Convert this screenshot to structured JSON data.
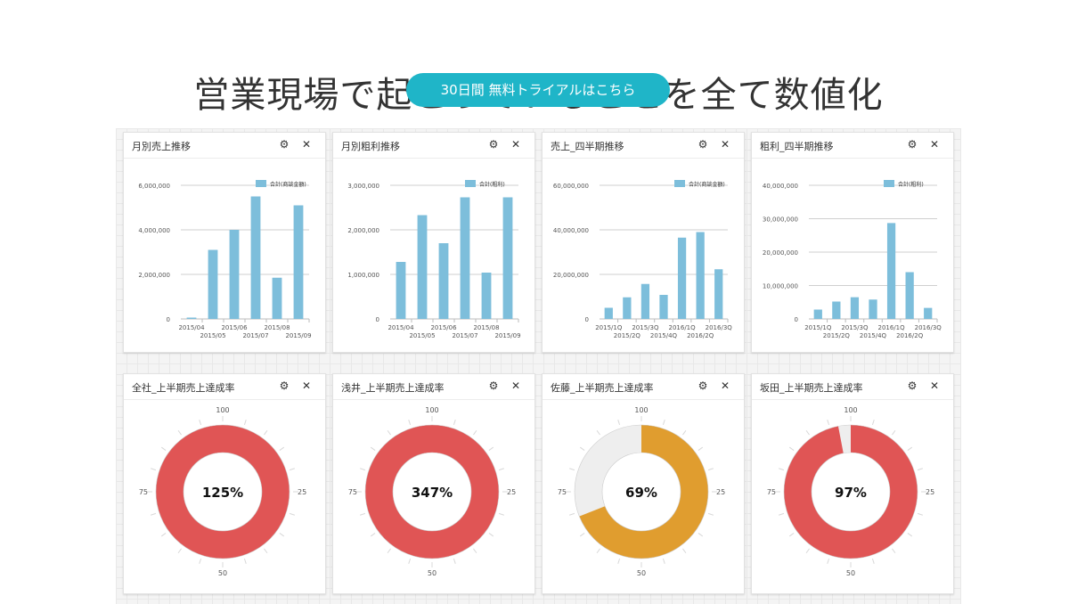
{
  "hero": {
    "headline": "営業現場で起こっていることを全て数値化",
    "cta_label": "30日間 無料トライアルはこちら"
  },
  "controls": {
    "gear_icon": "gear-icon",
    "close_icon": "close-icon"
  },
  "colors": {
    "bar": "#7dbedb",
    "red": "#e05555",
    "orange": "#e09d2f",
    "track": "#eeeeee",
    "cta": "#1fb5c8"
  },
  "panels": [
    {
      "title": "月別売上推移"
    },
    {
      "title": "月別粗利推移"
    },
    {
      "title": "売上_四半期推移"
    },
    {
      "title": "粗利_四半期推移"
    },
    {
      "title": "全社_上半期売上達成率"
    },
    {
      "title": "浅井_上半期売上達成率"
    },
    {
      "title": "佐藤_上半期売上達成率"
    },
    {
      "title": "坂田_上半期売上達成率"
    }
  ],
  "chart_data": [
    {
      "type": "bar",
      "legend": "合計(商談金額)",
      "categories": [
        "2015/04",
        "2015/05",
        "2015/06",
        "2015/07",
        "2015/08",
        "2015/09"
      ],
      "series": [
        {
          "name": "合計(商談金額)",
          "values": [
            60000,
            3100000,
            4000000,
            5500000,
            1850000,
            5100000
          ]
        }
      ],
      "yticks": [
        "0",
        "2,000,000",
        "4,000,000",
        "6,000,000"
      ],
      "ylim": [
        0,
        6000000
      ]
    },
    {
      "type": "bar",
      "legend": "合計(粗利)",
      "categories": [
        "2015/04",
        "2015/05",
        "2015/06",
        "2015/07",
        "2015/08",
        "2015/09"
      ],
      "series": [
        {
          "name": "合計(粗利)",
          "values": [
            1280000,
            2330000,
            1700000,
            2730000,
            1040000,
            2730000
          ]
        }
      ],
      "yticks": [
        "0",
        "1,000,000",
        "2,000,000",
        "3,000,000"
      ],
      "ylim": [
        0,
        3000000
      ]
    },
    {
      "type": "bar",
      "legend": "合計(商談金額)",
      "categories": [
        "2015/1Q",
        "2015/2Q",
        "2015/3Q",
        "2015/4Q",
        "2016/1Q",
        "2016/2Q",
        "2016/3Q"
      ],
      "series": [
        {
          "name": "合計(商談金額)",
          "values": [
            5000000,
            9700000,
            15700000,
            10800000,
            36500000,
            39000000,
            22300000
          ]
        }
      ],
      "yticks": [
        "0",
        "20,000,000",
        "40,000,000",
        "60,000,000"
      ],
      "ylim": [
        0,
        60000000
      ]
    },
    {
      "type": "bar",
      "legend": "合計(粗利)",
      "categories": [
        "2015/1Q",
        "2015/2Q",
        "2015/3Q",
        "2015/4Q",
        "2016/1Q",
        "2016/2Q",
        "2016/3Q"
      ],
      "series": [
        {
          "name": "合計(粗利)",
          "values": [
            2800000,
            5200000,
            6500000,
            5800000,
            28700000,
            14000000,
            3300000
          ]
        }
      ],
      "yticks": [
        "0",
        "10,000,000",
        "20,000,000",
        "30,000,000",
        "40,000,000"
      ],
      "ylim": [
        0,
        40000000
      ]
    },
    {
      "type": "gauge",
      "value_label": "125%",
      "fill": 1.0,
      "color": "#e05555",
      "ticks": [
        "100",
        "25",
        "50",
        "75"
      ]
    },
    {
      "type": "gauge",
      "value_label": "347%",
      "fill": 1.0,
      "color": "#e05555",
      "ticks": [
        "100",
        "25",
        "50",
        "75"
      ]
    },
    {
      "type": "gauge",
      "value_label": "69%",
      "fill": 0.69,
      "color": "#e09d2f",
      "ticks": [
        "100",
        "25",
        "50",
        "75"
      ]
    },
    {
      "type": "gauge",
      "value_label": "97%",
      "fill": 0.97,
      "color": "#e05555",
      "ticks": [
        "100",
        "25",
        "50",
        "75"
      ]
    }
  ]
}
